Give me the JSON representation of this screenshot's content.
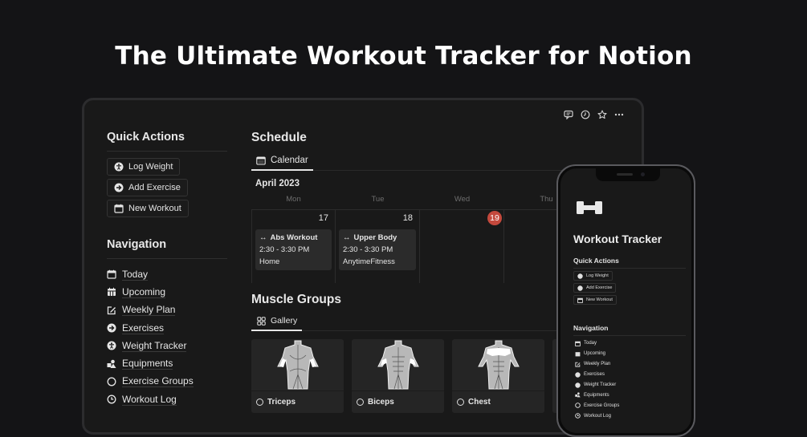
{
  "hero": {
    "title": "The Ultimate Workout Tracker for Notion"
  },
  "topbar": {
    "icons": [
      "comment-icon",
      "history-clock-icon",
      "star-icon",
      "more-options-icon"
    ]
  },
  "quick_actions": {
    "title": "Quick Actions",
    "buttons": [
      {
        "label": "Log Weight",
        "icon": "accessibility-icon"
      },
      {
        "label": "Add Exercise",
        "icon": "arrow-circle-right-icon"
      },
      {
        "label": "New Workout",
        "icon": "calendar-icon"
      }
    ]
  },
  "navigation": {
    "title": "Navigation",
    "items": [
      {
        "label": "Today",
        "icon": "calendar-icon"
      },
      {
        "label": "Upcoming",
        "icon": "calendar-grid-icon"
      },
      {
        "label": "Weekly Plan",
        "icon": "edit-square-icon"
      },
      {
        "label": "Exercises",
        "icon": "arrow-circle-right-icon"
      },
      {
        "label": "Weight Tracker",
        "icon": "accessibility-icon"
      },
      {
        "label": "Equipments",
        "icon": "shapes-icon"
      },
      {
        "label": "Exercise Groups",
        "icon": "circle-icon"
      },
      {
        "label": "Workout Log",
        "icon": "clock-icon"
      }
    ]
  },
  "schedule": {
    "title": "Schedule",
    "view_tab": "Calendar",
    "month": "April 2023",
    "weekdays": [
      "Mon",
      "Tue",
      "Wed",
      "Thu"
    ],
    "days": [
      {
        "num": "17",
        "today": false,
        "event": {
          "title": "Abs Workout",
          "time": "2:30 - 3:30 PM",
          "location": "Home"
        }
      },
      {
        "num": "18",
        "today": false,
        "event": {
          "title": "Upper Body",
          "time": "2:30 - 3:30 PM",
          "location": "AnytimeFitness"
        }
      },
      {
        "num": "19",
        "today": true,
        "event": null
      },
      {
        "num": "",
        "today": false,
        "event": null
      }
    ],
    "today_color": "#c4493d"
  },
  "muscle_groups": {
    "title": "Muscle Groups",
    "view_tab": "Gallery",
    "cards": [
      {
        "name": "Triceps",
        "highlight": "triceps"
      },
      {
        "name": "Biceps",
        "highlight": "biceps"
      },
      {
        "name": "Chest",
        "highlight": "chest"
      }
    ]
  },
  "phone": {
    "title": "Workout Tracker",
    "quick_actions_title": "Quick Actions",
    "quick_actions": [
      "Log Weight",
      "Add Exercise",
      "New Workout"
    ],
    "navigation_title": "Navigation",
    "navigation": [
      "Today",
      "Upcoming",
      "Weekly Plan",
      "Exercises",
      "Weight Tracker",
      "Equipments",
      "Exercise Groups",
      "Workout Log"
    ]
  }
}
